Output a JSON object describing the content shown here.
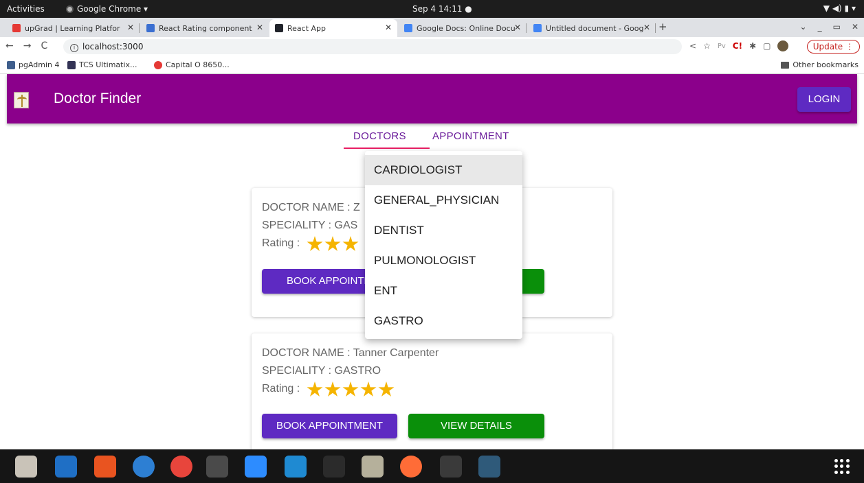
{
  "os": {
    "activities": "Activities",
    "app_menu": "Google Chrome ▾",
    "clock": "Sep 4  14:11  ●",
    "sys_icons": "▼  ◀)  ▮  ▾"
  },
  "browser": {
    "tabs": [
      {
        "label": "upGrad | Learning Platfor",
        "favicon_color": "#e53935"
      },
      {
        "label": "React Rating component",
        "favicon_color": "#3b6fd1"
      },
      {
        "label": "React App",
        "favicon_color": "#20232a"
      },
      {
        "label": "Google Docs: Online Docu",
        "favicon_color": "#4285f4"
      },
      {
        "label": "Untitled document - Goog",
        "favicon_color": "#4285f4"
      }
    ],
    "new_tab": "+",
    "url": "localhost:3000",
    "update_label": "Update  ⋮",
    "bookmarks": [
      {
        "label": "pgAdmin 4",
        "color": "#3f5e8c"
      },
      {
        "label": "TCS Ultimatix...",
        "color": "#335"
      },
      {
        "label": "Capital O 8650...",
        "color": "#e53935"
      }
    ],
    "other_bookmarks": "Other bookmarks"
  },
  "app": {
    "title": "Doctor Finder",
    "login": "LOGIN",
    "brand_color": "#8b008b",
    "tabs": [
      "DOCTORS",
      "APPOINTMENT"
    ],
    "menu": {
      "items": [
        "CARDIOLOGIST",
        "GENERAL_PHYSICIAN",
        "DENTIST",
        "PULMONOLOGIST",
        "ENT",
        "GASTRO"
      ],
      "selected": "CARDIOLOGIST"
    },
    "cards": [
      {
        "name_line": "DOCTOR NAME : Z",
        "speciality_line": "SPECIALITY : GAS",
        "rating_label": "Rating :",
        "rating": 3,
        "book": "BOOK APPOINTM",
        "view": ""
      },
      {
        "name_line": "DOCTOR NAME : Tanner Carpenter",
        "speciality_line": "SPECIALITY : GASTRO",
        "rating_label": "Rating :",
        "rating": 5,
        "book": "BOOK APPOINTMENT",
        "view": "VIEW DETAILS"
      }
    ]
  },
  "dock": {
    "apps": [
      {
        "name": "files",
        "color": "#c9c3b8"
      },
      {
        "name": "writer",
        "color": "#1f6fc5"
      },
      {
        "name": "app-center",
        "color": "#e95420"
      },
      {
        "name": "help",
        "color": "#2d7fd3"
      },
      {
        "name": "chrome",
        "color": "#e8453c"
      },
      {
        "name": "sublime",
        "color": "#4a4a4a"
      },
      {
        "name": "zoom",
        "color": "#2d8cff"
      },
      {
        "name": "vscode",
        "color": "#1f8ad2"
      },
      {
        "name": "intellij",
        "color": "#2b2b2b"
      },
      {
        "name": "archive",
        "color": "#b5b09b"
      },
      {
        "name": "postman",
        "color": "#ff6c37"
      },
      {
        "name": "terminal",
        "color": "#3a3a3a"
      },
      {
        "name": "mysql-workbench",
        "color": "#2f5a7a"
      }
    ]
  }
}
